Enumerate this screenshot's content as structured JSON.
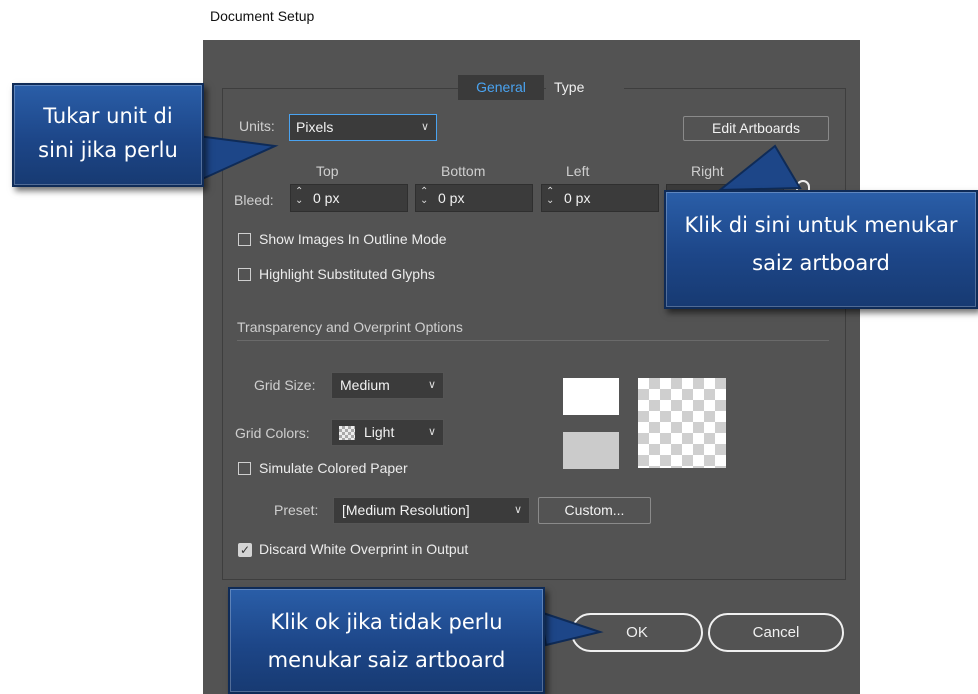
{
  "window_title": "Document Setup",
  "tabs": [
    {
      "label": "General",
      "active": true
    },
    {
      "label": "Type",
      "active": false
    }
  ],
  "units": {
    "label": "Units:",
    "value": "Pixels"
  },
  "edit_artboards_label": "Edit Artboards",
  "bleed": {
    "label": "Bleed:",
    "headers": {
      "top": "Top",
      "bottom": "Bottom",
      "left": "Left",
      "right": "Right"
    },
    "values": {
      "top": "0 px",
      "bottom": "0 px",
      "left": "0 px"
    }
  },
  "checkboxes": {
    "outline_mode": {
      "label": "Show Images In Outline Mode",
      "checked": false
    },
    "highlight_glyphs": {
      "label": "Highlight Substituted Glyphs",
      "checked": false
    },
    "simulate_paper": {
      "label": "Simulate Colored Paper",
      "checked": false
    },
    "discard_white": {
      "label": "Discard White Overprint in Output",
      "checked": true
    }
  },
  "transparency_section": "Transparency and Overprint Options",
  "grid_size": {
    "label": "Grid Size:",
    "value": "Medium"
  },
  "grid_colors": {
    "label": "Grid Colors:",
    "value": "Light"
  },
  "preset": {
    "label": "Preset:",
    "value": "[Medium Resolution]"
  },
  "custom_label": "Custom...",
  "ok_label": "OK",
  "cancel_label": "Cancel",
  "callouts": {
    "units": "Tukar unit di sini jika perlu",
    "artboards": "Klik di sini untuk menukar saiz artboard",
    "ok": "Klik ok jika tidak perlu menukar saiz artboard"
  },
  "colors": {
    "dialog_bg": "#535353",
    "accent_tab": "#4aa3f0",
    "callout_blue": "#1d4688"
  }
}
